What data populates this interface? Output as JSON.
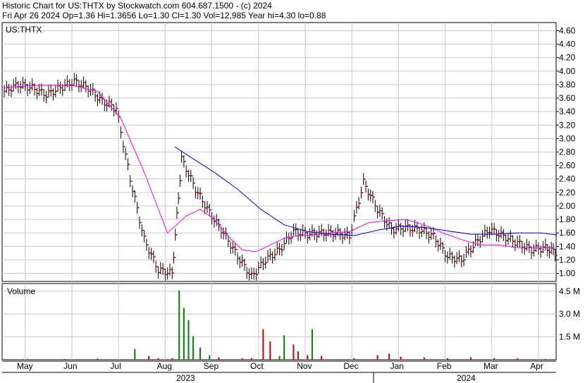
{
  "header": {
    "line1": "Historic Chart for US:THTX by Stockwatch.com 604.687.1500 - (c) 2024",
    "line2": "Fri Apr 26 2024  Op=1.36  Hi=1.3656  Lo=1.30  Cl=1.30  Vol=12,985  Year hi=4.30  lo=0.88"
  },
  "chart_data": [
    {
      "type": "line",
      "title": "US:THTX",
      "y_ticks": [
        "1.00",
        "1.20",
        "1.40",
        "1.60",
        "1.80",
        "2.00",
        "2.20",
        "2.40",
        "2.60",
        "2.80",
        "3.00",
        "3.20",
        "3.40",
        "3.60",
        "3.80",
        "4.00",
        "4.20",
        "4.40",
        "4.60"
      ],
      "ylim": [
        0.88,
        4.72
      ],
      "grid": true,
      "x_months": [
        "May",
        "Jun",
        "Jul",
        "Aug",
        "Sep",
        "Oct",
        "Nov",
        "Dec",
        "Jan",
        "Feb",
        "Mar",
        "Apr"
      ],
      "x_years": [
        "2023",
        "2024"
      ],
      "series": [
        {
          "name": "",
          "color": "#ff00ff",
          "x": [
            0.0,
            0.5,
            1.0,
            1.5,
            2.0,
            2.5,
            3.0,
            3.5,
            3.9,
            4.2,
            4.5,
            4.8,
            5.1,
            5.4,
            5.7,
            6.0,
            6.3,
            6.6,
            7.0,
            7.4,
            7.8,
            8.2,
            8.6,
            9.0,
            9.4,
            9.8,
            10.2,
            10.6,
            11.0,
            11.4,
            11.8
          ],
          "y": [
            3.75,
            3.78,
            3.79,
            3.78,
            3.7,
            3.3,
            2.5,
            1.6,
            1.85,
            1.95,
            1.8,
            1.55,
            1.35,
            1.32,
            1.42,
            1.52,
            1.56,
            1.57,
            1.6,
            1.62,
            1.75,
            1.78,
            1.8,
            1.72,
            1.6,
            1.5,
            1.42,
            1.42,
            1.38,
            1.38,
            1.38
          ]
        },
        {
          "name": "",
          "color": "#0000ff",
          "x": [
            3.65,
            4.0,
            4.5,
            5.0,
            5.5,
            6.0,
            6.5,
            7.0,
            7.5,
            8.0,
            8.5,
            9.0,
            9.5,
            10.0,
            10.5,
            11.0,
            11.5,
            11.85
          ],
          "y": [
            2.88,
            2.72,
            2.5,
            2.25,
            1.95,
            1.72,
            1.62,
            1.58,
            1.56,
            1.64,
            1.7,
            1.68,
            1.63,
            1.58,
            1.58,
            1.6,
            1.6,
            1.57
          ]
        },
        {
          "name": "",
          "color": "#000000",
          "style": "bars",
          "x": [
            0.0,
            0.3,
            0.6,
            0.9,
            1.2,
            1.5,
            1.8,
            2.1,
            2.4,
            2.7,
            3.0,
            3.3,
            3.6,
            3.8,
            4.1,
            4.4,
            4.7,
            5.0,
            5.3,
            5.6,
            5.9,
            6.2,
            6.5,
            6.8,
            7.1,
            7.4,
            7.7,
            8.0,
            8.3,
            8.6,
            8.9,
            9.2,
            9.5,
            9.8,
            10.1,
            10.4,
            10.7,
            11.0,
            11.3,
            11.6,
            11.85
          ],
          "y": [
            3.7,
            3.8,
            3.75,
            3.65,
            3.75,
            3.85,
            3.75,
            3.55,
            3.45,
            2.4,
            1.5,
            1.05,
            1.0,
            2.7,
            2.25,
            1.9,
            1.6,
            1.25,
            0.95,
            1.2,
            1.35,
            1.62,
            1.58,
            1.6,
            1.6,
            1.55,
            2.35,
            1.95,
            1.65,
            1.68,
            1.65,
            1.55,
            1.25,
            1.2,
            1.45,
            1.65,
            1.55,
            1.45,
            1.35,
            1.38,
            1.3
          ]
        }
      ]
    },
    {
      "type": "bar",
      "title": "Volume",
      "y_ticks": [
        "1.5 M",
        "3.0 M",
        "4.5 M"
      ],
      "ylim": [
        0,
        5.0
      ],
      "x": [
        0.5,
        1.3,
        2.0,
        2.8,
        3.1,
        3.3,
        3.6,
        3.75,
        3.85,
        3.95,
        4.05,
        4.2,
        4.4,
        4.6,
        5.1,
        5.3,
        5.55,
        5.7,
        5.9,
        6.0,
        6.2,
        6.3,
        6.5,
        6.6,
        6.8,
        7.5,
        8.0,
        8.25,
        8.5,
        9.0,
        9.5,
        10.0,
        10.5,
        11.0,
        11.6
      ],
      "values": [
        0.05,
        0.05,
        0.08,
        0.7,
        0.25,
        0.1,
        0.1,
        4.55,
        3.4,
        2.6,
        1.55,
        0.8,
        0.3,
        0.15,
        0.1,
        0.1,
        2.0,
        1.2,
        0.25,
        1.6,
        1.0,
        0.55,
        0.3,
        2.0,
        0.25,
        0.1,
        0.3,
        0.4,
        0.2,
        0.15,
        0.1,
        0.15,
        0.1,
        0.1,
        0.05
      ],
      "up_color": "#008000",
      "down_color": "#cc0000",
      "colors": [
        "r",
        "r",
        "r",
        "g",
        "r",
        "r",
        "r",
        "g",
        "g",
        "g",
        "g",
        "g",
        "g",
        "r",
        "r",
        "r",
        "r",
        "r",
        "g",
        "g",
        "r",
        "r",
        "r",
        "g",
        "r",
        "r",
        "r",
        "r",
        "r",
        "r",
        "r",
        "r",
        "r",
        "r",
        "r"
      ]
    }
  ]
}
